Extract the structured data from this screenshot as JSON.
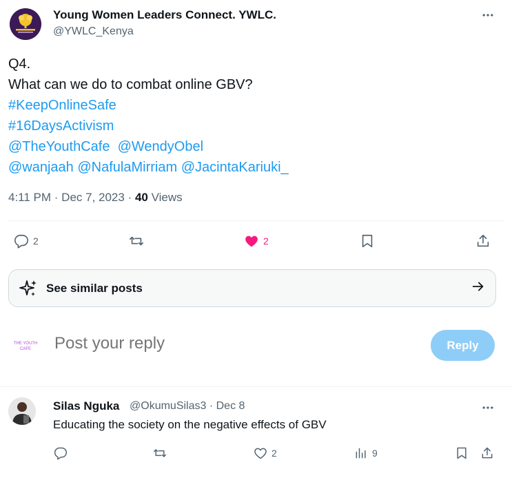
{
  "tweet": {
    "display_name": "Young Women Leaders Connect. YWLC.",
    "handle": "@YWLC_Kenya",
    "lines": {
      "l1": "Q4.",
      "l2": "What can we do to combat online GBV?",
      "hashtag1": "#KeepOnlineSafe",
      "hashtag2": "#16DaysActivism",
      "mention1": "@TheYouthCafe",
      "mention2": "@WendyObel",
      "mention3": "@wanjaah",
      "mention4": "@NafulaMirriam",
      "mention5": "@JacintaKariuki_"
    },
    "time": "4:11 PM",
    "date": "Dec 7, 2023",
    "views_count": "40",
    "views_label": "Views",
    "actions": {
      "reply_count": "2",
      "like_count": "2"
    }
  },
  "similar": {
    "label": "See similar posts"
  },
  "composer": {
    "placeholder": "Post your reply",
    "button": "Reply",
    "avatar_text": "THE YOUTH CAFE"
  },
  "reply": {
    "display_name": "Silas Nguka",
    "handle": "@OkumuSilas3",
    "date": "Dec 8",
    "text": "Educating the society on the negative effects of GBV",
    "like_count": "2",
    "view_count": "9"
  },
  "colors": {
    "accent": "#1d9bf0",
    "like": "#f91880",
    "muted": "#536471",
    "reply_button": "#8ecdf8"
  },
  "icons": [
    "more-icon",
    "reply-icon",
    "retweet-icon",
    "heart-icon",
    "bookmark-icon",
    "share-icon",
    "sparkle-icon",
    "arrow-right-icon",
    "analytics-icon"
  ]
}
